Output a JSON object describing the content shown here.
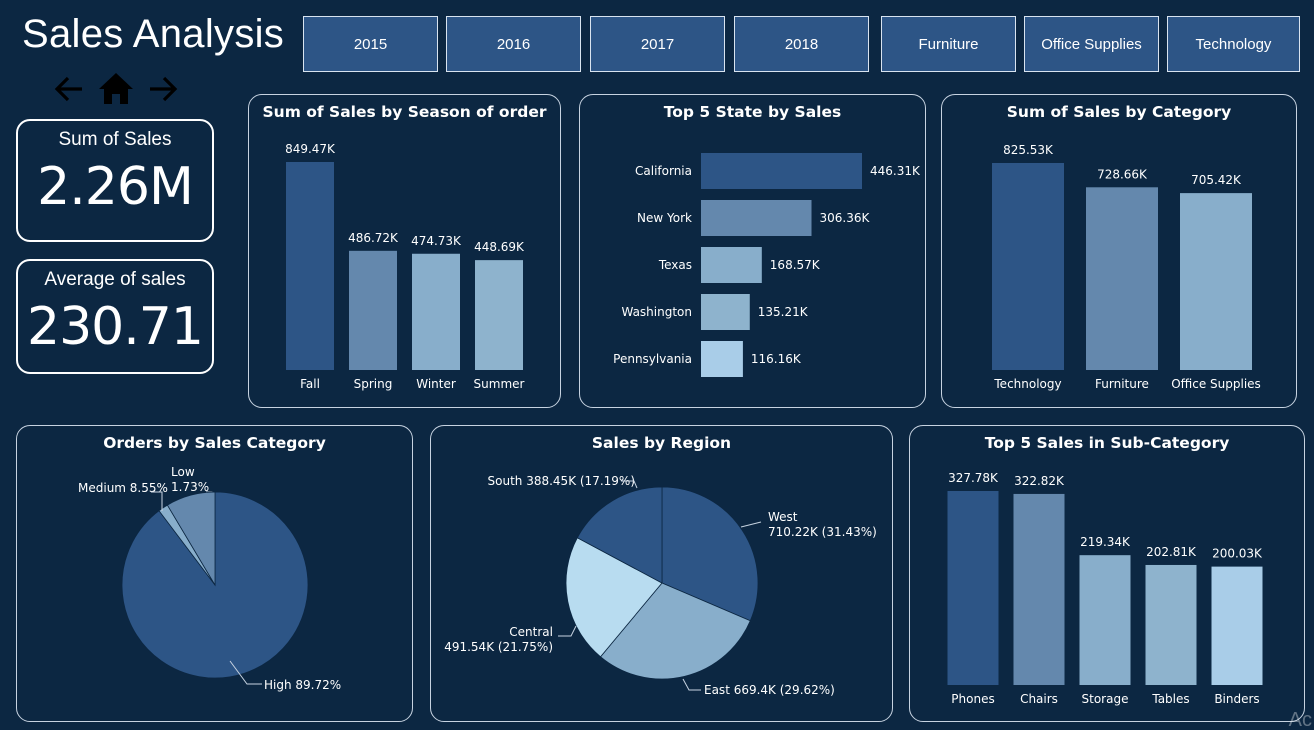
{
  "page": {
    "title": "Sales Analysis"
  },
  "nav": {
    "icons": [
      "back-arrow-icon",
      "home-icon",
      "forward-arrow-icon"
    ]
  },
  "slicers": {
    "years": [
      "2015",
      "2016",
      "2017",
      "2018"
    ],
    "categories": [
      "Furniture",
      "Office Supplies",
      "Technology"
    ]
  },
  "kpis": {
    "sum_of_sales": {
      "label": "Sum of Sales",
      "value": "2.26M"
    },
    "average_of_sales": {
      "label": "Average of sales",
      "value": "230.71"
    }
  },
  "colors": {
    "background": "#0c2742",
    "button": "#2d5586",
    "series": [
      "#2d5586",
      "#6488ad",
      "#88aecb",
      "#8eb3cd",
      "#a9cde8"
    ]
  },
  "watermark": "Ac",
  "chart_data": [
    {
      "id": "season",
      "type": "bar",
      "title": "Sum of Sales by Season of order",
      "categories": [
        "Fall",
        "Spring",
        "Winter",
        "Summer"
      ],
      "values": [
        849.47,
        486.72,
        474.73,
        448.69
      ],
      "labels": [
        "849.47K",
        "486.72K",
        "474.73K",
        "448.69K"
      ],
      "colors": [
        "#2d5586",
        "#6488ad",
        "#88aecb",
        "#8eb3cd"
      ],
      "xlabel": "",
      "ylabel": ""
    },
    {
      "id": "states",
      "type": "bar",
      "orientation": "horizontal",
      "title": "Top 5 State by Sales",
      "categories": [
        "California",
        "New York",
        "Texas",
        "Washington",
        "Pennsylvania"
      ],
      "values": [
        446.31,
        306.36,
        168.57,
        135.21,
        116.16
      ],
      "labels": [
        "446.31K",
        "306.36K",
        "168.57K",
        "135.21K",
        "116.16K"
      ],
      "colors": [
        "#2d5586",
        "#6488ad",
        "#88aecb",
        "#8eb3cd",
        "#a9cde8"
      ],
      "xlabel": "",
      "ylabel": ""
    },
    {
      "id": "category",
      "type": "bar",
      "title": "Sum of Sales by Category",
      "categories": [
        "Technology",
        "Furniture",
        "Office Supplies"
      ],
      "values": [
        825.53,
        728.66,
        705.42
      ],
      "labels": [
        "825.53K",
        "728.66K",
        "705.42K"
      ],
      "colors": [
        "#2d5586",
        "#6488ad",
        "#88aecb"
      ],
      "xlabel": "",
      "ylabel": ""
    },
    {
      "id": "orders",
      "type": "pie",
      "title": "Orders by Sales Category",
      "slices": [
        {
          "name": "High",
          "value": 89.72,
          "label": "High 89.72%",
          "color": "#2d5586"
        },
        {
          "name": "Low",
          "value": 1.73,
          "label": "Low\n1.73%",
          "color": "#88aecb"
        },
        {
          "name": "Medium",
          "value": 8.55,
          "label": "Medium 8.55%",
          "color": "#6488ad"
        }
      ]
    },
    {
      "id": "region",
      "type": "pie",
      "title": "Sales by Region",
      "slices": [
        {
          "name": "West",
          "value": 710.22,
          "label": "West\n710.22K (31.43%)",
          "color": "#2d5586"
        },
        {
          "name": "East",
          "value": 669.4,
          "label": "East 669.4K (29.62%)",
          "color": "#88aecb"
        },
        {
          "name": "Central",
          "value": 491.54,
          "label": "Central\n491.54K (21.75%)",
          "color": "#b8dcf0"
        },
        {
          "name": "South",
          "value": 388.45,
          "label": "South 388.45K (17.19%)",
          "color": "#2d5586"
        }
      ]
    },
    {
      "id": "subcat",
      "type": "bar",
      "title": "Top 5 Sales in Sub-Category",
      "categories": [
        "Phones",
        "Chairs",
        "Storage",
        "Tables",
        "Binders"
      ],
      "values": [
        327.78,
        322.82,
        219.34,
        202.81,
        200.03
      ],
      "labels": [
        "327.78K",
        "322.82K",
        "219.34K",
        "202.81K",
        "200.03K"
      ],
      "colors": [
        "#2d5586",
        "#6488ad",
        "#88aecb",
        "#8eb3cd",
        "#a9cde8"
      ],
      "xlabel": "",
      "ylabel": ""
    }
  ]
}
